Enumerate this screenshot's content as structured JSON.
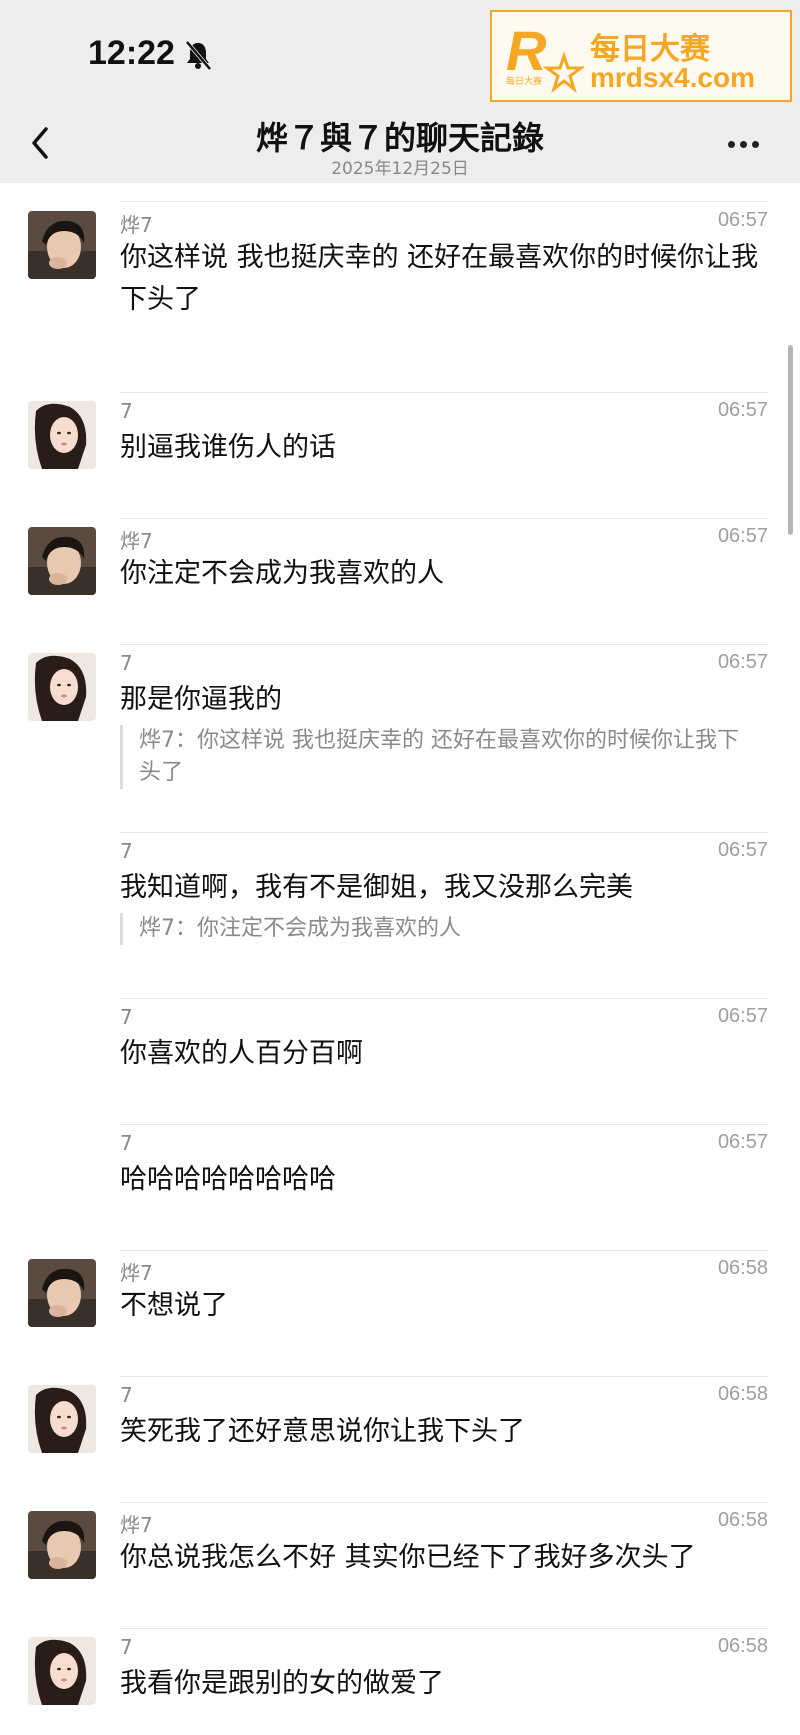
{
  "status": {
    "time": "12:22"
  },
  "watermark": {
    "logo_letter": "R",
    "logo_small": "每日大赛",
    "name": "每日大赛",
    "url": "mrdsx4.com"
  },
  "header": {
    "title": "烨７與７的聊天記錄",
    "date": "2025年12月25日"
  },
  "colors": {
    "bar_bg": "#ededed",
    "watermark": "#f5a623"
  },
  "messages": [
    {
      "sender": "烨7",
      "time": "06:57",
      "text": "你这样说 我也挺庆幸的 还好在最喜欢你的时候你让我下头了",
      "avatar": "avatar-boy",
      "quote": ""
    },
    {
      "sender": "7",
      "time": "06:57",
      "text": "别逼我谁伤人的话",
      "avatar": "avatar-girl",
      "quote": ""
    },
    {
      "sender": "烨7",
      "time": "06:57",
      "text": "你注定不会成为我喜欢的人",
      "avatar": "avatar-boy",
      "quote": ""
    },
    {
      "sender": "7",
      "time": "06:57",
      "text": "那是你逼我的",
      "avatar": "avatar-girl",
      "quote": "烨7：你这样说 我也挺庆幸的 还好在最喜欢你的时候你让我下头了"
    },
    {
      "sender": "7",
      "time": "06:57",
      "text": "我知道啊，我有不是御姐，我又没那么完美",
      "avatar": "",
      "quote": "烨7：你注定不会成为我喜欢的人"
    },
    {
      "sender": "7",
      "time": "06:57",
      "text": "你喜欢的人百分百啊",
      "avatar": "",
      "quote": ""
    },
    {
      "sender": "7",
      "time": "06:57",
      "text": "哈哈哈哈哈哈哈哈",
      "avatar": "",
      "quote": ""
    },
    {
      "sender": "烨7",
      "time": "06:58",
      "text": "不想说了",
      "avatar": "avatar-boy",
      "quote": ""
    },
    {
      "sender": "7",
      "time": "06:58",
      "text": "笑死我了还好意思说你让我下头了",
      "avatar": "avatar-girl",
      "quote": ""
    },
    {
      "sender": "烨7",
      "time": "06:58",
      "text": "你总说我怎么不好 其实你已经下了我好多次头了",
      "avatar": "avatar-boy",
      "quote": ""
    },
    {
      "sender": "7",
      "time": "06:58",
      "text": "我看你是跟别的女的做爱了",
      "avatar": "avatar-girl",
      "quote": ""
    }
  ]
}
